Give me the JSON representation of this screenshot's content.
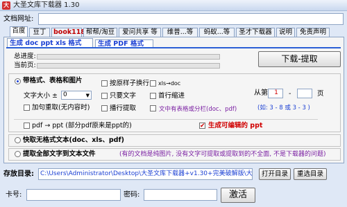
{
  "window": {
    "title": "大圣文库下载器 1.30",
    "icon_text": "大"
  },
  "url": {
    "label": "文档网址:",
    "value": ""
  },
  "tabs": [
    {
      "label": "百度"
    },
    {
      "label": "豆丁"
    },
    {
      "label": "book118"
    },
    {
      "label": "帮帮/淘豆"
    },
    {
      "label": "爱问共享 等"
    },
    {
      "label": "维普...等"
    },
    {
      "label": "蚂蚁...等"
    },
    {
      "label": "圣才下载器"
    },
    {
      "label": "说明"
    },
    {
      "label": "免责声明"
    }
  ],
  "subtabs": [
    {
      "label": "生成 doc ppt xls 格式"
    },
    {
      "label": "生成 PDF 格式"
    }
  ],
  "progress": {
    "total_label": "总进度:",
    "current_label": "当前页:",
    "total_value": 0,
    "current_value": 0
  },
  "download_button": "下载-提取",
  "options": {
    "with_format": "带格式、表格和图片",
    "font_size_label": "文字大小 ±",
    "font_size_value": "0",
    "bold_add": "加句重取(无内容时)",
    "by_original_wrap": "按原样子换行",
    "text_only": "只要文字",
    "chapter_extract": "播行提取",
    "xls_to_doc": "xls→doc",
    "first_indent": "首行缩进",
    "columns_note": "文中有表格或分栏(doc、pdf)",
    "from_label": "从第",
    "from_value": "1",
    "dash": "-",
    "page_label": "页",
    "range_hint": "(如: 3 - 8  或 3 - 3 )",
    "pdf_to_ppt": "pdf → ppt (部分pdf原来是ppt的)",
    "generate_editable_ppt": "生成可编辑的 ppt",
    "fast_no_format": "快取无格式文本(doc、xls、pdf)",
    "extract_all_text": "提取全部文字到文本文件",
    "image_note": "(有的文档是纯图片, 没有文字可提取或提取到的不全面, 不是下载器的问题)"
  },
  "save": {
    "label": "存放目录:",
    "path": "C:\\Users\\Administrator\\Desktop\\大圣文库下载器+v1.30+完美破解版\\大圣",
    "open_button": "打开目录",
    "reselect_button": "重选目录"
  },
  "account": {
    "card_label": "卡号:",
    "card_value": "",
    "password_label": "密码:",
    "password_value": "",
    "activate_button": "激活"
  }
}
